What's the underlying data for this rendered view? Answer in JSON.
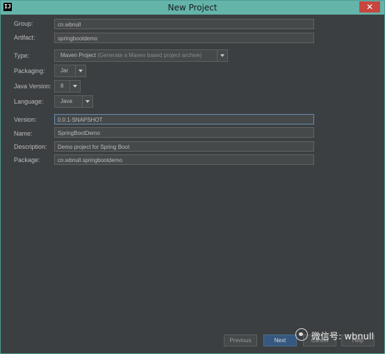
{
  "window": {
    "title": "New Project",
    "app_icon_text": "IJ",
    "close_glyph": "✕"
  },
  "form": {
    "group": {
      "label": "Group:",
      "value": "cn.wbnull"
    },
    "artifact": {
      "label": "Artifact:",
      "value": "springbootdemo"
    },
    "type": {
      "label": "Type:",
      "value": "Maven Project",
      "hint": "(Generate a Maven based project archive)"
    },
    "packaging": {
      "label": "Packaging:",
      "value": "Jar"
    },
    "java_version": {
      "label": "Java Version:",
      "value": "8"
    },
    "language": {
      "label": "Language:",
      "value": "Java"
    },
    "version": {
      "label": "Version:",
      "value": "0.0.1-SNAPSHOT"
    },
    "name": {
      "label": "Name:",
      "value": "SpringBootDemo"
    },
    "description": {
      "label": "Description:",
      "value": "Demo project for Spring Boot"
    },
    "package": {
      "label": "Package:",
      "value": "cn.wbnull.springbootdemo"
    }
  },
  "buttons": {
    "previous": "Previous",
    "next": "Next",
    "cancel": "Cancel",
    "help": "Help"
  },
  "watermark": {
    "text": "微信号: wbnull"
  },
  "colors": {
    "background": "#3c3f41",
    "titlebar": "#64b4aa",
    "close": "#c7463f",
    "field": "#45494a",
    "primary_button": "#365880",
    "text": "#bbbbbb"
  }
}
